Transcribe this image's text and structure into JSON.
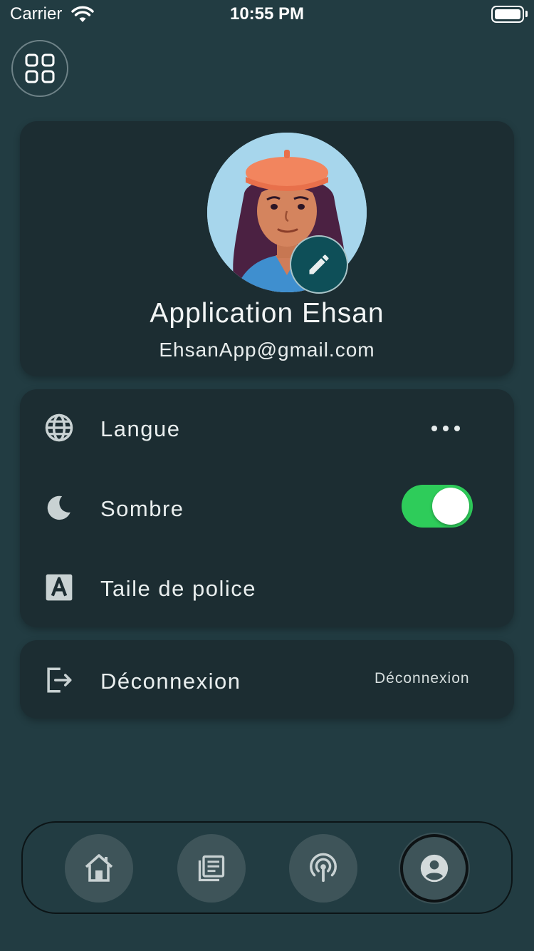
{
  "status_bar": {
    "carrier": "Carrier",
    "time": "10:55 PM"
  },
  "profile": {
    "name": "Application Ehsan",
    "email": "EhsanApp@gmail.com"
  },
  "settings": {
    "language_label": "Langue",
    "dark_mode_label": "Sombre",
    "dark_mode_on": true,
    "font_size_label": "Taile de police"
  },
  "logout": {
    "label": "Déconnexion",
    "action_label": "Déconnexion"
  },
  "bottom_nav": {
    "items": [
      "home-icon",
      "news-icon",
      "podcast-icon",
      "profile-icon"
    ],
    "active": "profile-icon"
  },
  "colors": {
    "background": "#223c42",
    "card": "#1c2d32",
    "toggle_on": "#2ecc5a",
    "edit_button": "#0e4f58",
    "nav_button": "#3e5459"
  }
}
